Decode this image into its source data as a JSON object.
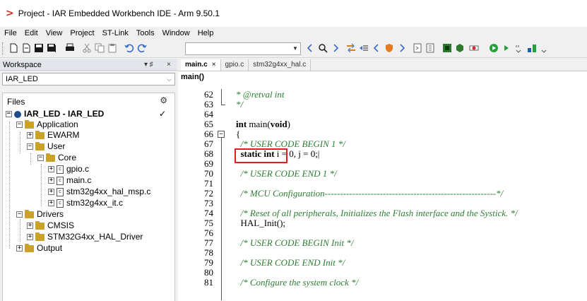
{
  "window": {
    "logo": ">",
    "title": "Project - IAR Embedded Workbench IDE - Arm 9.50.1"
  },
  "menu": [
    "File",
    "Edit",
    "View",
    "Project",
    "ST-Link",
    "Tools",
    "Window",
    "Help"
  ],
  "toolbar": {
    "search_value": ""
  },
  "workspace": {
    "title": "Workspace",
    "pin": "▾ ♯",
    "close": "×",
    "config": "IAR_LED",
    "files_label": "Files",
    "tree": [
      {
        "label": "IAR_LED - IAR_LED",
        "kind": "project",
        "bold": true
      },
      {
        "label": "Application",
        "kind": "folder"
      },
      {
        "label": "EWARM",
        "kind": "folder"
      },
      {
        "label": "User",
        "kind": "folder"
      },
      {
        "label": "Core",
        "kind": "folder"
      },
      {
        "label": "gpio.c",
        "kind": "file"
      },
      {
        "label": "main.c",
        "kind": "file"
      },
      {
        "label": "stm32g4xx_hal_msp.c",
        "kind": "file"
      },
      {
        "label": "stm32g4xx_it.c",
        "kind": "file"
      },
      {
        "label": "Drivers",
        "kind": "folder"
      },
      {
        "label": "CMSIS",
        "kind": "folder"
      },
      {
        "label": "STM32G4xx_HAL_Driver",
        "kind": "folder"
      },
      {
        "label": "Output",
        "kind": "folder"
      }
    ]
  },
  "editor": {
    "tabs": [
      {
        "label": "main.c",
        "active": true,
        "close": "×"
      },
      {
        "label": "gpio.c",
        "active": false
      },
      {
        "label": "stm32g4xx_hal.c",
        "active": false
      }
    ],
    "function": "main()",
    "line_numbers": [
      "62",
      "63",
      "64",
      "65",
      "66",
      "67",
      "68",
      "69",
      "70",
      "71",
      "72",
      "73",
      "74",
      "75",
      "76",
      "77",
      "78",
      "79",
      "80",
      "81"
    ],
    "lines": [
      "* @retval int",
      "*/",
      "",
      "int main(void)",
      "{",
      "  /* USER CODE BEGIN 1 */",
      "  static int i = 0, j = 0;",
      "",
      "  /* USER CODE END 1 */",
      "",
      "  /* MCU Configuration--------------------------------------------------------*/",
      "",
      "  /* Reset of all peripherals, Initializes the Flash interface and the Systick. */",
      "  HAL_Init();",
      "",
      "  /* USER CODE BEGIN Init */",
      "",
      "  /* USER CODE END Init */",
      "",
      "  /* Configure the system clock */"
    ]
  },
  "colors": {
    "accent_red": "#e02020",
    "comment_green": "#2e7d32",
    "folder_gold": "#c9a227"
  }
}
